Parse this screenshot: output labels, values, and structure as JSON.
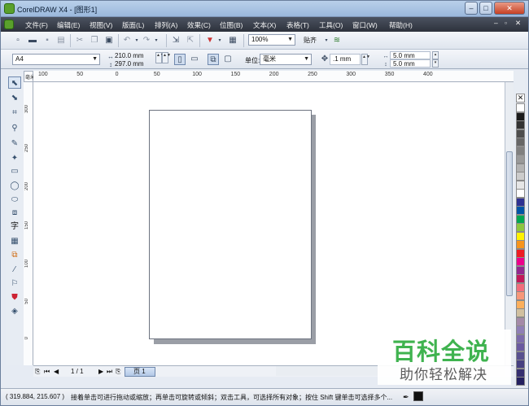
{
  "window": {
    "title": "CorelDRAW X4 - [图形1]",
    "controls": [
      "–",
      "□",
      "✕"
    ],
    "doc_controls": [
      "–",
      "▫",
      "✕"
    ]
  },
  "menubar": [
    "文件(F)",
    "编辑(E)",
    "视图(V)",
    "版面(L)",
    "排列(A)",
    "效果(C)",
    "位图(B)",
    "文本(X)",
    "表格(T)",
    "工具(O)",
    "窗口(W)",
    "帮助(H)"
  ],
  "toolbar1": {
    "zoom": "100%",
    "snap": "贴齐",
    "icons": [
      "new-icon",
      "open-icon",
      "save-icon",
      "print-icon",
      "cut-icon",
      "copy-icon",
      "paste-icon",
      "undo-icon",
      "redo-icon",
      "import-icon",
      "export-icon",
      "launcher-icon",
      "welcome-icon",
      "options-icon"
    ]
  },
  "propertybar": {
    "paper": "A4",
    "width": "210.0 mm",
    "height": "297.0 mm",
    "units_label": "单位:",
    "units": "毫米",
    "nudge": ".1 mm",
    "dup_x": "5.0 mm",
    "dup_y": "5.0 mm"
  },
  "rulers": {
    "unit_mark": "毫米",
    "h_ticks": [
      "100",
      "50",
      "0",
      "50",
      "100",
      "150",
      "200",
      "250",
      "300",
      "350",
      "400"
    ],
    "v_ticks": [
      "300",
      "250",
      "200",
      "150",
      "100",
      "50",
      "0"
    ]
  },
  "tools": [
    "pick-tool",
    "shape-tool",
    "crop-tool",
    "zoom-tool",
    "freehand-tool",
    "smart-fill-tool",
    "rectangle-tool",
    "ellipse-tool",
    "polygon-tool",
    "basic-shapes-tool",
    "text-tool",
    "table-tool",
    "interactive-blend-tool",
    "eyedropper-tool",
    "outline-tool",
    "fill-tool",
    "interactive-fill-tool"
  ],
  "palette": {
    "colors": [
      "#ffffff",
      "#1a1a1a",
      "#333333",
      "#4d4d4d",
      "#666666",
      "#808080",
      "#999999",
      "#b3b3b3",
      "#cccccc",
      "#e6e6e6",
      "#ffffff",
      "#2e3192",
      "#0054a6",
      "#00a651",
      "#8dc63f",
      "#fff200",
      "#f7941d",
      "#ed1c24",
      "#ec008c",
      "#92278f",
      "#c2185b",
      "#f26d7d",
      "#f7977a",
      "#fbaf5d",
      "#d0c0a0",
      "#a48aa8",
      "#8f7fb6",
      "#7c6bab",
      "#6a5aa0",
      "#58508f",
      "#464080",
      "#352f70",
      "#242060"
    ]
  },
  "pagebar": {
    "counter": "1 / 1",
    "tab": "页 1"
  },
  "status": {
    "coords": "( 319.884, 215.607 )",
    "hint": "接着单击可进行拖动或缩放；再单击可旋转或倾斜；双击工具，可选择所有对象；按住 Shift 键单击可选择多个..."
  },
  "watermark": {
    "line1": "百科全说",
    "line2": "助你轻松解决"
  }
}
